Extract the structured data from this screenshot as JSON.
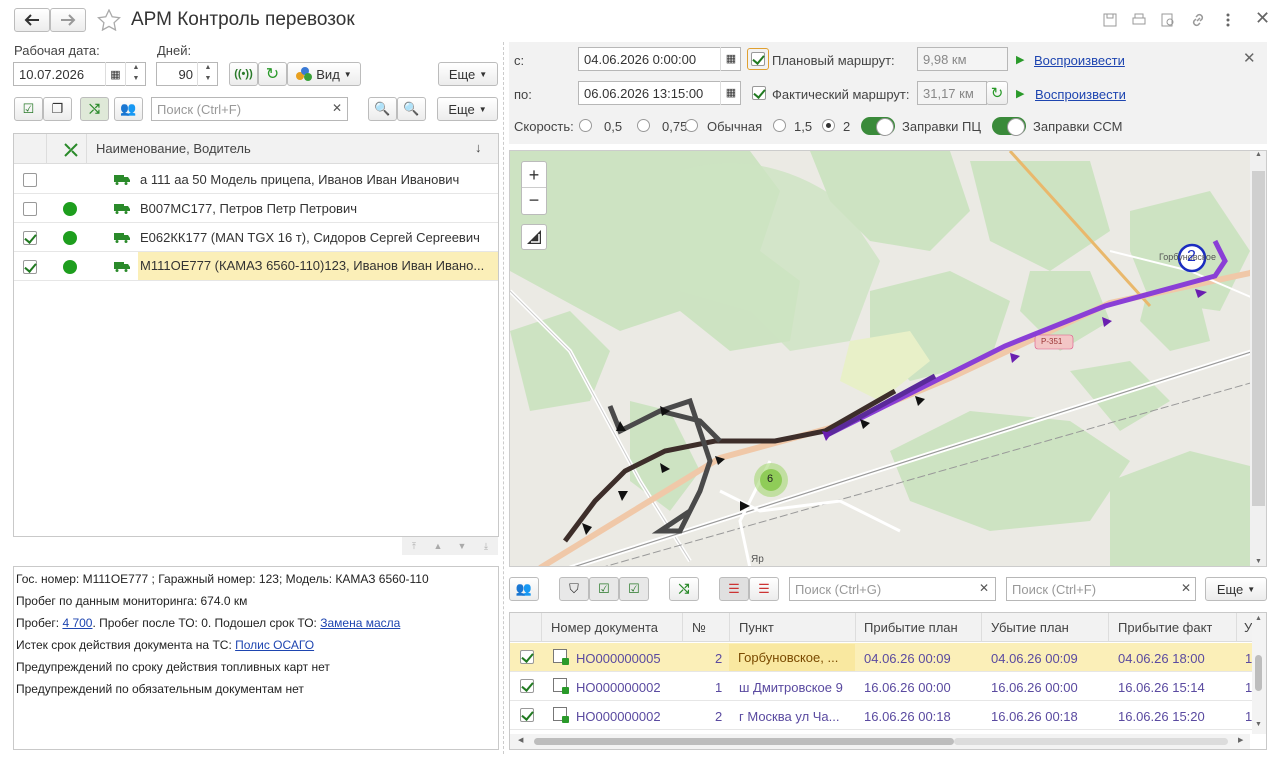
{
  "window": {
    "title": "АРМ Контроль перевозок"
  },
  "left": {
    "work_date_label": "Рабочая дата:",
    "work_date_value": "10.07.2026",
    "days_label": "Дней:",
    "days_value": "90",
    "view_label": "Вид",
    "more_label": "Еще",
    "search_placeholder": "Поиск (Ctrl+F)",
    "more2_label": "Еще",
    "column_name": "Наименование, Водитель",
    "rows": [
      {
        "checked": false,
        "online": false,
        "name": "а 111 аа 50 Модель прицепа, Иванов Иван Иванович"
      },
      {
        "checked": false,
        "online": true,
        "name": "В007МС177, Петров Петр Петрович"
      },
      {
        "checked": true,
        "online": true,
        "name": "Е062КК177 (MAN TGX 16 т), Сидоров Сергей Сергеевич"
      },
      {
        "checked": true,
        "online": true,
        "name": "М111ОЕ777 (КАМАЗ 6560-110)123, Иванов Иван Ивано..."
      }
    ],
    "info": {
      "line1": "Гос. номер: М111ОЕ777 ; Гаражный номер: 123; Модель: КАМАЗ 6560-110",
      "line2": "Пробег по данным мониторинга: 674.0 км",
      "line3_prefix": "Пробег: ",
      "line3_link": "4 700",
      "line3_middle": ". Пробег после ТО: 0. Подошел срок ТО: ",
      "line3_link2": "Замена масла",
      "line4_prefix": "Истек срок действия документа на ТС: ",
      "line4_link": "Полис ОСАГО",
      "line5": "Предупреждений по сроку действия топливных карт нет",
      "line6": "Предупреждений по обязательным документам нет"
    }
  },
  "right": {
    "from_label": "с:",
    "from_value": "04.06.2026  0:00:00",
    "to_label": "по:",
    "to_value": "06.06.2026 13:15:00",
    "planned_label": "Плановый маршрут:",
    "planned_value": "9,98 км",
    "actual_label": "Фактический маршрут:",
    "actual_value": "31,17 км",
    "play1": "Воспроизвести",
    "play2": "Воспроизвести",
    "speed_label": "Скорость:",
    "speeds": [
      "0,5",
      "0,75",
      "Обычная",
      "1,5",
      "2"
    ],
    "speed_selected": "2",
    "fuel_pc": "Заправки ПЦ",
    "fuel_ssm": "Заправки ССМ",
    "map": {
      "road_label": "Р-351",
      "village1": "Горбуновское",
      "village2": "Яр",
      "cluster_count": "6",
      "point_number": "2"
    },
    "search_g_placeholder": "Поиск (Ctrl+G)",
    "search_f_placeholder": "Поиск (Ctrl+F)",
    "more_label": "Еще",
    "columns": [
      "Номер документа",
      "№",
      "Пункт",
      "Прибытие план",
      "Убытие план",
      "Прибытие факт",
      "У"
    ],
    "rows": [
      {
        "doc": "НО000000005",
        "num": "2",
        "point": "Горбуновское, ...",
        "arr_plan": "04.06.26 00:09",
        "dep_plan": "04.06.26 00:09",
        "arr_fact": "04.06.26 18:00",
        "extra": "1"
      },
      {
        "doc": "НО000000002",
        "num": "1",
        "point": " ш Дмитровское 9",
        "arr_plan": "16.06.26 00:00",
        "dep_plan": "16.06.26 00:00",
        "arr_fact": "16.06.26 15:14",
        "extra": "1"
      },
      {
        "doc": "НО000000002",
        "num": "2",
        "point": "г Москва ул Ча...",
        "arr_plan": "16.06.26 00:18",
        "dep_plan": "16.06.26 00:18",
        "arr_fact": "16.06.26 15:20",
        "extra": "1"
      }
    ]
  },
  "colors": {
    "accent_green": "#1e9e1e",
    "link": "#1e45b0",
    "selected_row": "#fbefb8",
    "route_purple": "#8a3fd6"
  }
}
